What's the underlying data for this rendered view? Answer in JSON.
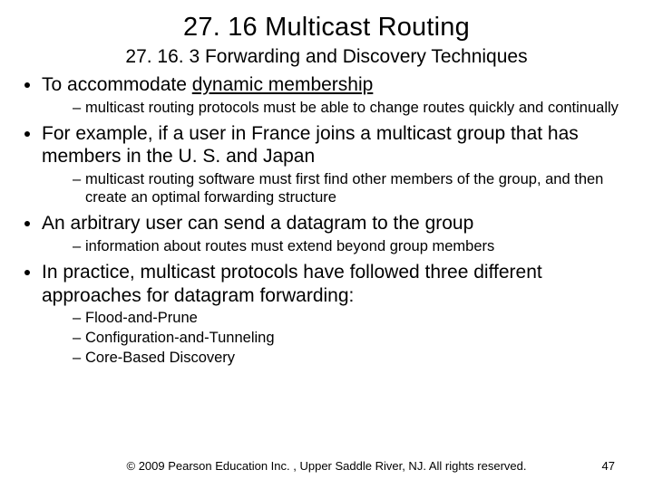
{
  "title": "27. 16  Multicast Routing",
  "subtitle": "27. 16. 3  Forwarding and Discovery Techniques",
  "bullets": [
    {
      "text_pre": "To accommodate ",
      "emph": "dynamic membership",
      "text_post": "",
      "sub": [
        "multicast routing protocols must be able to change routes quickly and continually"
      ]
    },
    {
      "text_pre": "For example, if a user in France joins a multicast group that has members in the U. S. and Japan",
      "emph": "",
      "text_post": "",
      "sub": [
        "multicast routing software must first find other members of the group, and then create an optimal forwarding structure"
      ]
    },
    {
      "text_pre": "An arbitrary user can send a datagram to the group",
      "emph": "",
      "text_post": "",
      "sub": [
        "information about routes must extend beyond group members"
      ]
    },
    {
      "text_pre": "In practice, multicast protocols have followed three different approaches for datagram forwarding:",
      "emph": "",
      "text_post": "",
      "sub": [
        "Flood-and-Prune",
        "Configuration-and-Tunneling",
        "Core-Based Discovery"
      ]
    }
  ],
  "footer": "© 2009 Pearson Education Inc. , Upper Saddle River, NJ.  All rights reserved.",
  "page": "47"
}
